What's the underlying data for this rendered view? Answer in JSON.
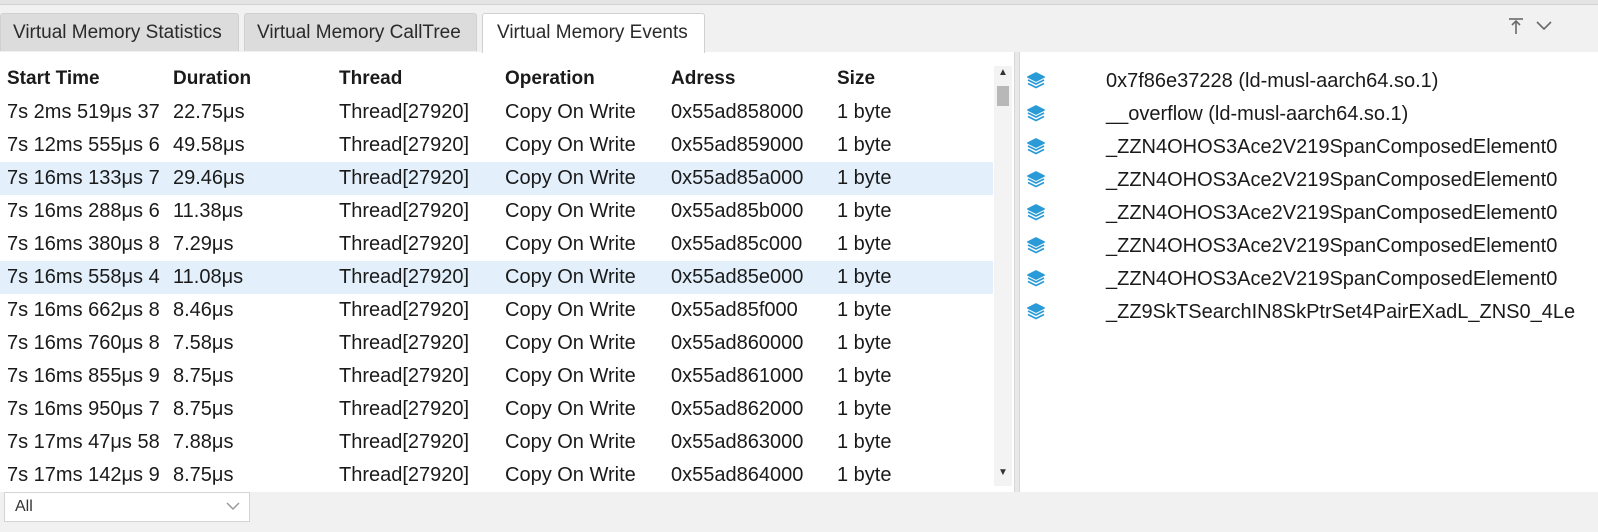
{
  "tabs": [
    {
      "label": "Virtual Memory Statistics",
      "active": false
    },
    {
      "label": "Virtual Memory CallTree",
      "active": false
    },
    {
      "label": "Virtual Memory Events",
      "active": true
    }
  ],
  "tab_controls": {
    "maximize_glyph": "⤒",
    "collapse_glyph": "⌄"
  },
  "table": {
    "columns": [
      "Start Time",
      "Duration",
      "Thread",
      "Operation",
      "Adress",
      "Size"
    ],
    "rows": [
      [
        "7s 2ms 519μs 37",
        "22.75μs",
        "Thread[27920]",
        "Copy On Write",
        "0x55ad858000",
        "1 byte"
      ],
      [
        "7s 12ms 555μs 6",
        "49.58μs",
        "Thread[27920]",
        "Copy On Write",
        "0x55ad859000",
        "1 byte"
      ],
      [
        "7s 16ms 133μs 7",
        "29.46μs",
        "Thread[27920]",
        "Copy On Write",
        "0x55ad85a000",
        "1 byte"
      ],
      [
        "7s 16ms 288μs 6",
        "11.38μs",
        "Thread[27920]",
        "Copy On Write",
        "0x55ad85b000",
        "1 byte"
      ],
      [
        "7s 16ms 380μs 8",
        "7.29μs",
        "Thread[27920]",
        "Copy On Write",
        "0x55ad85c000",
        "1 byte"
      ],
      [
        "7s 16ms 558μs 4",
        "11.08μs",
        "Thread[27920]",
        "Copy On Write",
        "0x55ad85e000",
        "1 byte"
      ],
      [
        "7s 16ms 662μs 8",
        "8.46μs",
        "Thread[27920]",
        "Copy On Write",
        "0x55ad85f000",
        "1 byte"
      ],
      [
        "7s 16ms 760μs 8",
        "7.58μs",
        "Thread[27920]",
        "Copy On Write",
        "0x55ad860000",
        "1 byte"
      ],
      [
        "7s 16ms 855μs 9",
        "8.75μs",
        "Thread[27920]",
        "Copy On Write",
        "0x55ad861000",
        "1 byte"
      ],
      [
        "7s 16ms 950μs 7",
        "8.75μs",
        "Thread[27920]",
        "Copy On Write",
        "0x55ad862000",
        "1 byte"
      ],
      [
        "7s 17ms 47μs 58",
        "7.88μs",
        "Thread[27920]",
        "Copy On Write",
        "0x55ad863000",
        "1 byte"
      ],
      [
        "7s 17ms 142μs 9",
        "8.75μs",
        "Thread[27920]",
        "Copy On Write",
        "0x55ad864000",
        "1 byte"
      ]
    ],
    "highlighted_rows": [
      2,
      5
    ]
  },
  "scrollbar": {
    "up_glyph": "▲",
    "down_glyph": "▼"
  },
  "callstack": [
    "0x7f86e37228 (ld-musl-aarch64.so.1)",
    "__overflow (ld-musl-aarch64.so.1)",
    "_ZZN4OHOS3Ace2V219SpanComposedElement0",
    "_ZZN4OHOS3Ace2V219SpanComposedElement0",
    "_ZZN4OHOS3Ace2V219SpanComposedElement0",
    "_ZZN4OHOS3Ace2V219SpanComposedElement0",
    "_ZZN4OHOS3Ace2V219SpanComposedElement0",
    "_ZZ9SkTSearchIN8SkPtrSet4PairEXadL_ZNS0_4Le"
  ],
  "colors": {
    "stack_icon": "#2a9bd6",
    "row_highlight": "#e3f0fc"
  },
  "footer": {
    "filter_value": "All"
  }
}
